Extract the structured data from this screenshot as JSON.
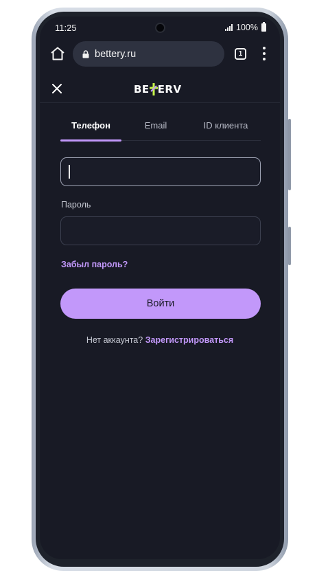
{
  "status_bar": {
    "time": "11:25",
    "battery": "100%"
  },
  "browser": {
    "url": "bettery.ru",
    "tab_count": "1"
  },
  "site": {
    "logo_left": "BE",
    "logo_right": "ERV",
    "close_icon": "close-icon"
  },
  "tabs": [
    {
      "label": "Телефон",
      "active": true
    },
    {
      "label": "Email",
      "active": false
    },
    {
      "label": "ID клиента",
      "active": false
    }
  ],
  "form": {
    "phone_value": "",
    "password_label": "Пароль",
    "password_value": "",
    "forgot_link": "Забыл пароль?",
    "login_button": "Войти",
    "no_account_text": "Нет аккаунта?",
    "register_link": "Зарегистрироваться"
  },
  "colors": {
    "accent": "#c298fa",
    "background": "#181a25",
    "field_border": "#3c4050",
    "logo_accent": "#c6f34a"
  }
}
